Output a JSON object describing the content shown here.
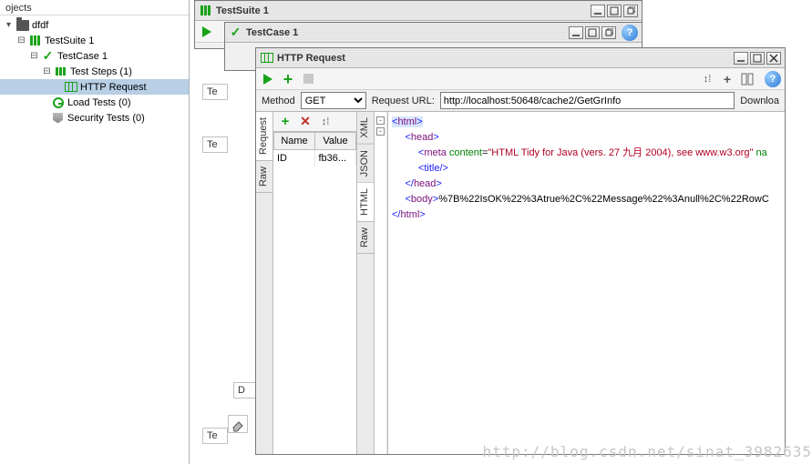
{
  "projects": {
    "header": "ojects",
    "root_folder": "dfdf",
    "suite": "TestSuite 1",
    "testcase": "TestCase 1",
    "steps_label": "Test Steps (1)",
    "http_step": "HTTP Request",
    "load_tests": "Load Tests (0)",
    "security_tests": "Security Tests (0)"
  },
  "win_suite": {
    "title": "TestSuite 1"
  },
  "win_case": {
    "title": "TestCase 1"
  },
  "peek_tc": "Te",
  "peek_d": "D",
  "peek_te": "Te",
  "win_http": {
    "title": "HTTP Request",
    "method_label": "Method",
    "method_value": "GET",
    "url_label": "Request URL:",
    "url_value": "http://localhost:50648/cache2/GetGrInfo",
    "download": "Downloa",
    "req_tabs": {
      "request": "Request",
      "raw": "Raw"
    },
    "resp_tabs": {
      "xml": "XML",
      "json": "JSON",
      "html": "HTML",
      "raw": "Raw"
    },
    "params": {
      "col_name": "Name",
      "col_value": "Value",
      "row0_name": "ID",
      "row0_value": "fb36..."
    },
    "response": {
      "l1_open": "<",
      "l1_tag": "html",
      "l1_close": ">",
      "l2_open": "<",
      "l2_tag": "head",
      "l2_close": ">",
      "l3_open": "<",
      "l3_tag": "meta ",
      "l3_attn": "content",
      "l3_eq": "=",
      "l3_attv": "\"HTML Tidy for Java (vers. 27 九月 2004), see www.w3.org\"",
      "l3_rest": " na",
      "l4": "<title/>",
      "l5_open": "</",
      "l5_tag": "head",
      "l5_close": ">",
      "l6_open": "<",
      "l6_tag": "body",
      "l6_close": ">",
      "l6_body": "%7B%22IsOK%22%3Atrue%2C%22Message%22%3Anull%2C%22RowC",
      "l7_open": "</",
      "l7_tag": "html",
      "l7_close": ">"
    }
  },
  "watermark": "http://blog.csdn.net/sinat_3982635"
}
